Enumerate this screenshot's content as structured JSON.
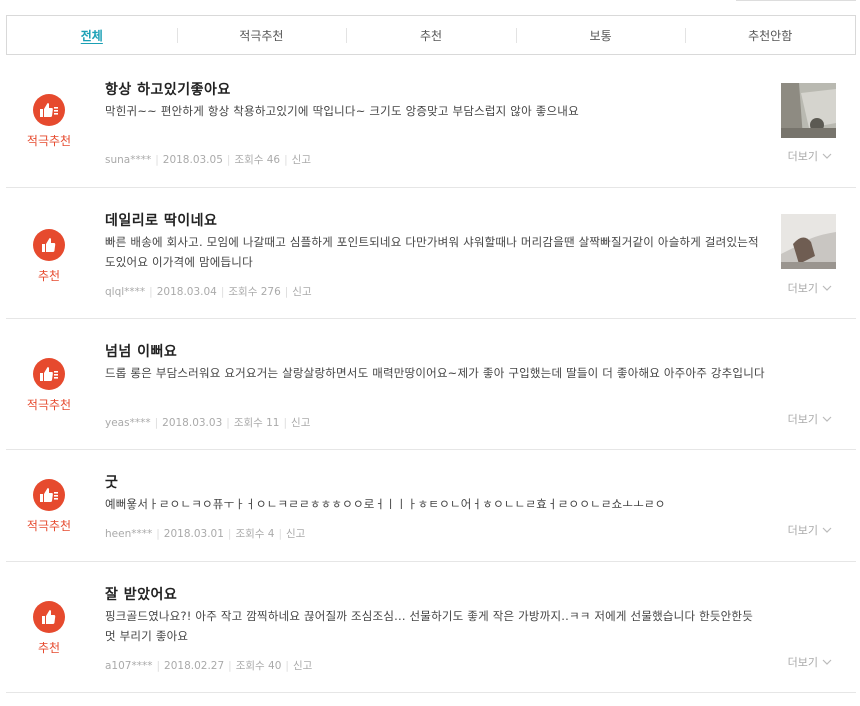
{
  "tabs": [
    "전체",
    "적극추천",
    "추천",
    "보통",
    "추천안함"
  ],
  "more_label": "더보기",
  "reviews": [
    {
      "badge": "적극추천",
      "title": "항상 하고있기좋아요",
      "body": "막힌귀~~ 편안하게 항상 착용하고있기에 딱입니다~ 크기도 앙증맞고 부담스럽지 않아 좋으내요",
      "user": "suna****",
      "date": "2018.03.05",
      "views": "조회수 46",
      "report": "신고"
    },
    {
      "badge": "추천",
      "title": "데일리로 딱이네요",
      "body": "빠른 배송에 회사고. 모임에 나갈때고 심플하게 포인트되네요 다만가벼워 샤워할때나 머리감을땐 살짝빠질거같이 아슬하게 걸려있는적도있어요 이가격에 맘에듭니다",
      "user": "qlql****",
      "date": "2018.03.04",
      "views": "조회수 276",
      "report": "신고"
    },
    {
      "badge": "적극추천",
      "title": "넘넘 이뻐요",
      "body": "드롭 롱은 부담스러워요 요거요거는 살랑살랑하면서도 매력만땅이어요~제가 좋아 구입했는데 딸들이 더 좋아해요 아주아주 강추입니다",
      "user": "yeas****",
      "date": "2018.03.03",
      "views": "조회수 11",
      "report": "신고"
    },
    {
      "badge": "적극추천",
      "title": "굿",
      "body": "예뻐욯서ㅏㄹㅇㄴㅋㅇ퓨ㅜㅏㅓㅇㄴㅋㄹㄹㅎㅎㅎㅇㅇ로ㅓㅣㅣㅏㅎㅌㅇㄴ어ㅓㅎㅇㄴㄴㄹ효ㅓㄹㅇㅇㄴㄹ쇼ㅗㅗㄹㅇ",
      "user": "heen****",
      "date": "2018.03.01",
      "views": "조회수 4",
      "report": "신고"
    },
    {
      "badge": "추천",
      "title": "잘 받았어요",
      "body": "핑크골드였나요?! 아주 작고 깜찍하네요 끊어질까 조심조심... 선물하기도 좋게 작은 가방까지..ㅋㅋ 저에게 선물했습니다 한듯안한듯 멋 부리기 좋아요",
      "user": "a107****",
      "date": "2018.02.27",
      "views": "조회수 40",
      "report": "신고"
    }
  ]
}
